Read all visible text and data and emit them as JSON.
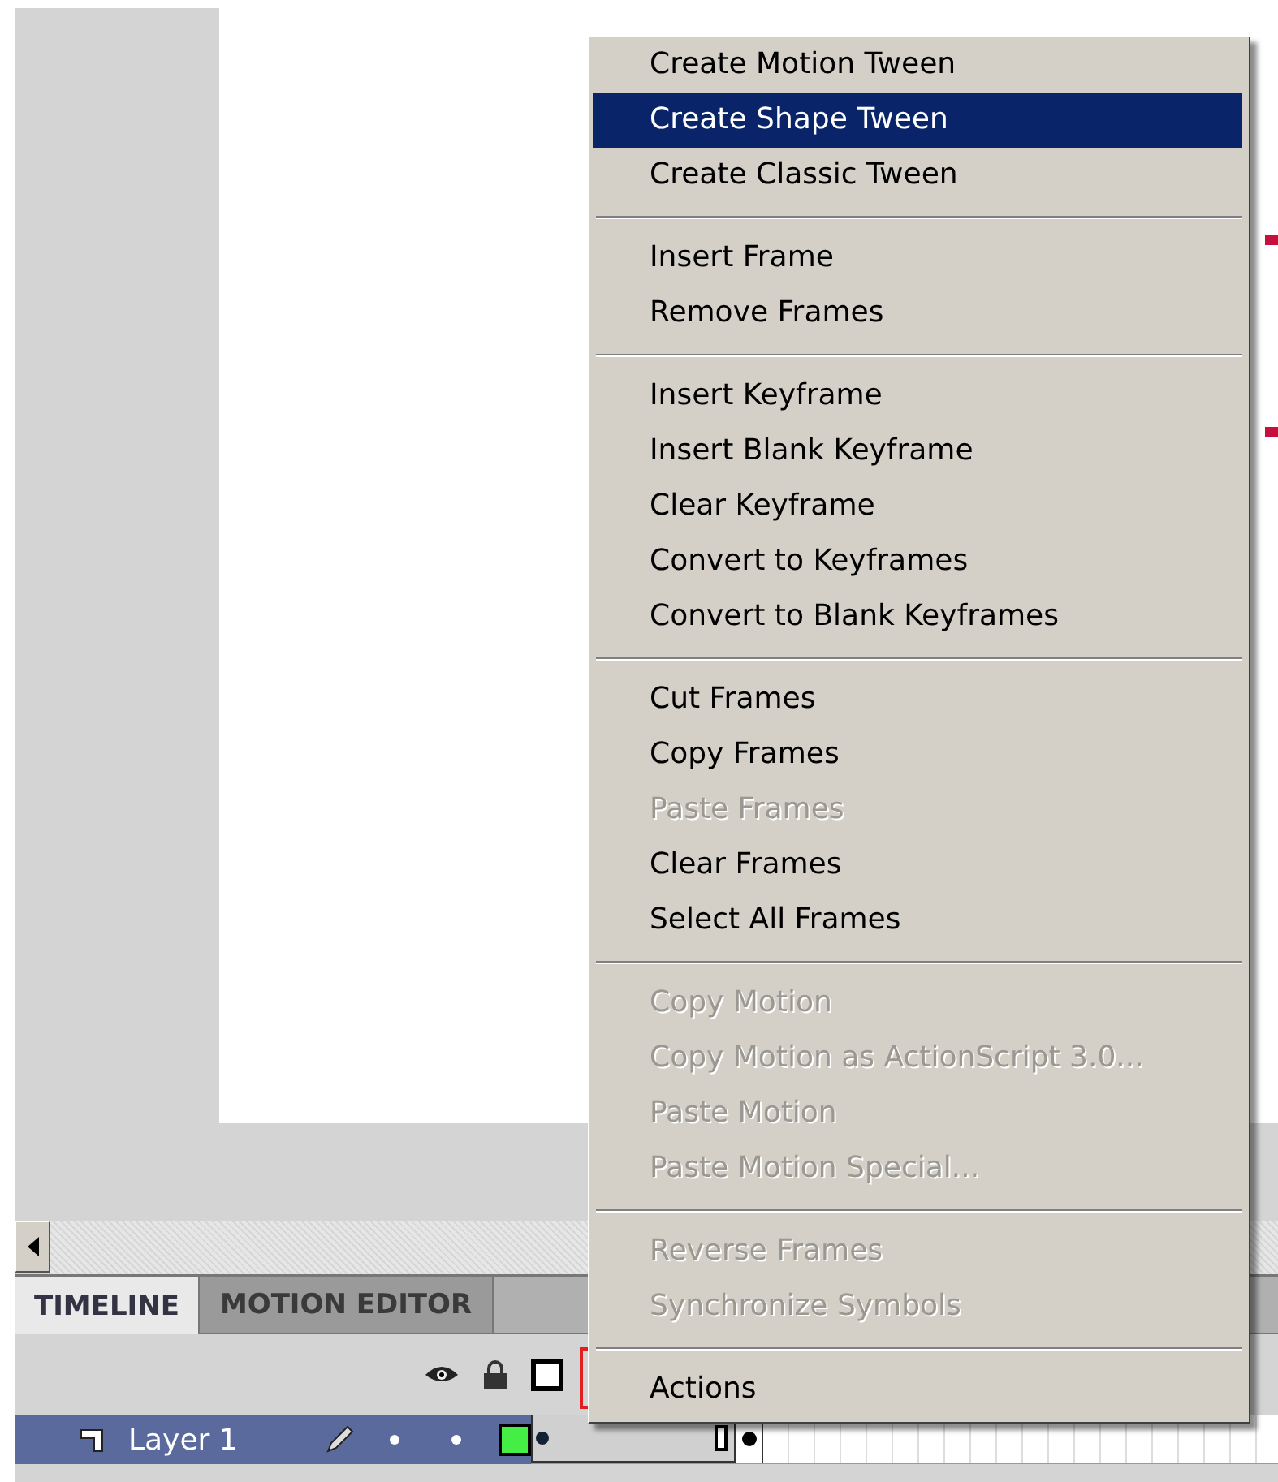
{
  "menu": {
    "items": [
      {
        "kind": "item",
        "label": "Create Motion Tween",
        "selected": false,
        "disabled": false
      },
      {
        "kind": "item",
        "label": "Create Shape Tween",
        "selected": true,
        "disabled": false
      },
      {
        "kind": "item",
        "label": "Create Classic Tween",
        "selected": false,
        "disabled": false
      },
      {
        "kind": "separator"
      },
      {
        "kind": "item",
        "label": "Insert Frame",
        "selected": false,
        "disabled": false
      },
      {
        "kind": "item",
        "label": "Remove Frames",
        "selected": false,
        "disabled": false
      },
      {
        "kind": "separator"
      },
      {
        "kind": "item",
        "label": "Insert Keyframe",
        "selected": false,
        "disabled": false
      },
      {
        "kind": "item",
        "label": "Insert Blank Keyframe",
        "selected": false,
        "disabled": false
      },
      {
        "kind": "item",
        "label": "Clear Keyframe",
        "selected": false,
        "disabled": false
      },
      {
        "kind": "item",
        "label": "Convert to Keyframes",
        "selected": false,
        "disabled": false
      },
      {
        "kind": "item",
        "label": "Convert to Blank Keyframes",
        "selected": false,
        "disabled": false
      },
      {
        "kind": "separator"
      },
      {
        "kind": "item",
        "label": "Cut Frames",
        "selected": false,
        "disabled": false
      },
      {
        "kind": "item",
        "label": "Copy Frames",
        "selected": false,
        "disabled": false
      },
      {
        "kind": "item",
        "label": "Paste Frames",
        "selected": false,
        "disabled": true
      },
      {
        "kind": "item",
        "label": "Clear Frames",
        "selected": false,
        "disabled": false
      },
      {
        "kind": "item",
        "label": "Select All Frames",
        "selected": false,
        "disabled": false
      },
      {
        "kind": "separator"
      },
      {
        "kind": "item",
        "label": "Copy Motion",
        "selected": false,
        "disabled": true
      },
      {
        "kind": "item",
        "label": "Copy Motion as ActionScript 3.0...",
        "selected": false,
        "disabled": true
      },
      {
        "kind": "item",
        "label": "Paste Motion",
        "selected": false,
        "disabled": true
      },
      {
        "kind": "item",
        "label": "Paste Motion Special...",
        "selected": false,
        "disabled": true
      },
      {
        "kind": "separator"
      },
      {
        "kind": "item",
        "label": "Reverse Frames",
        "selected": false,
        "disabled": true
      },
      {
        "kind": "item",
        "label": "Synchronize Symbols",
        "selected": false,
        "disabled": true
      },
      {
        "kind": "separator"
      },
      {
        "kind": "item",
        "label": "Actions",
        "selected": false,
        "disabled": false
      }
    ]
  },
  "timeline": {
    "tabs": [
      {
        "label": "TIMELINE",
        "selected": true
      },
      {
        "label": "MOTION EDITOR",
        "selected": false
      }
    ],
    "layers": [
      {
        "name": "Layer 1",
        "selected": true
      }
    ]
  }
}
